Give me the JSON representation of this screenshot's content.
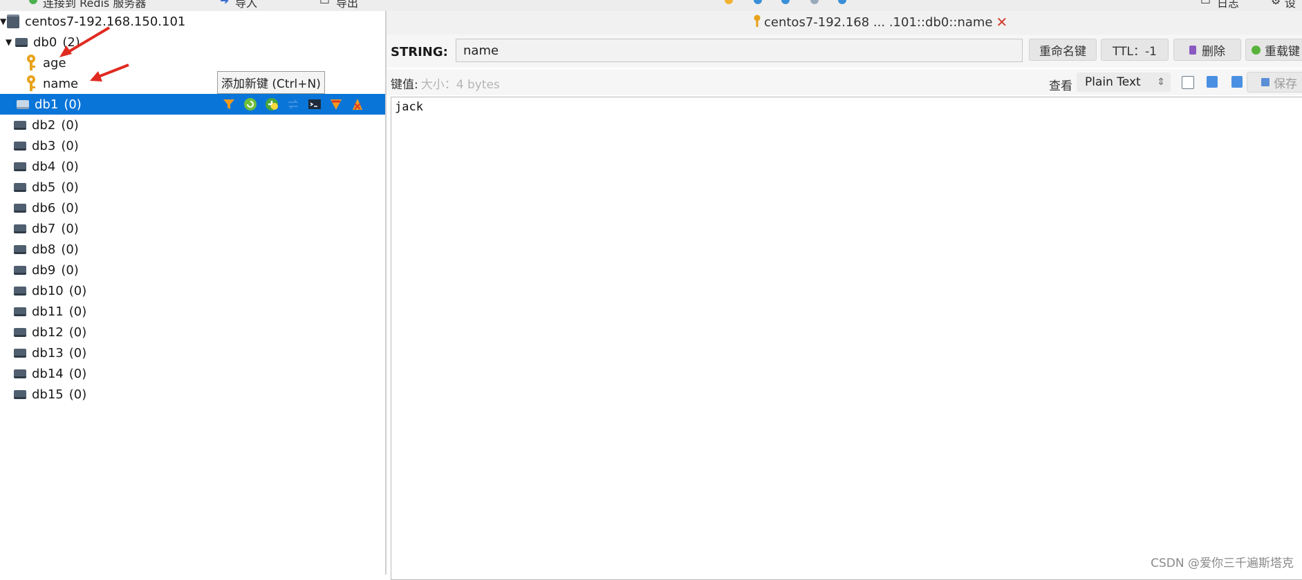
{
  "topbar": {
    "connect_label": "连接到 Redis 服务器",
    "import_label": "导入",
    "export_label": "导出",
    "log_label": "日志",
    "settings_label": "设"
  },
  "tree": {
    "connection": "centos7-192.168.150.101",
    "db0": {
      "name": "db0",
      "count": "(2)"
    },
    "keys": [
      "age",
      "name"
    ],
    "databases": [
      {
        "name": "db1",
        "count": "(0)"
      },
      {
        "name": "db2",
        "count": "(0)"
      },
      {
        "name": "db3",
        "count": "(0)"
      },
      {
        "name": "db4",
        "count": "(0)"
      },
      {
        "name": "db5",
        "count": "(0)"
      },
      {
        "name": "db6",
        "count": "(0)"
      },
      {
        "name": "db7",
        "count": "(0)"
      },
      {
        "name": "db8",
        "count": "(0)"
      },
      {
        "name": "db9",
        "count": "(0)"
      },
      {
        "name": "db10",
        "count": "(0)"
      },
      {
        "name": "db11",
        "count": "(0)"
      },
      {
        "name": "db12",
        "count": "(0)"
      },
      {
        "name": "db13",
        "count": "(0)"
      },
      {
        "name": "db14",
        "count": "(0)"
      },
      {
        "name": "db15",
        "count": "(0)"
      }
    ],
    "tooltip": "添加新键 (Ctrl+N)",
    "selected_color": "#0a75d8"
  },
  "tab": {
    "title": "centos7-192.168 ... .101::db0::name",
    "close": "✕"
  },
  "key_view": {
    "type_label": "STRING:",
    "key_name": "name",
    "rename_label": "重命名键",
    "ttl_label": "TTL：-1",
    "delete_label": "删除",
    "reload_label": "重载键",
    "value_label": "键值:",
    "size_label": "大小：4 bytes",
    "view_label": "查看",
    "view_mode": "Plain Text",
    "save_label": "保存",
    "value": "jack"
  },
  "watermark": "CSDN @爱你三千遍斯塔克"
}
